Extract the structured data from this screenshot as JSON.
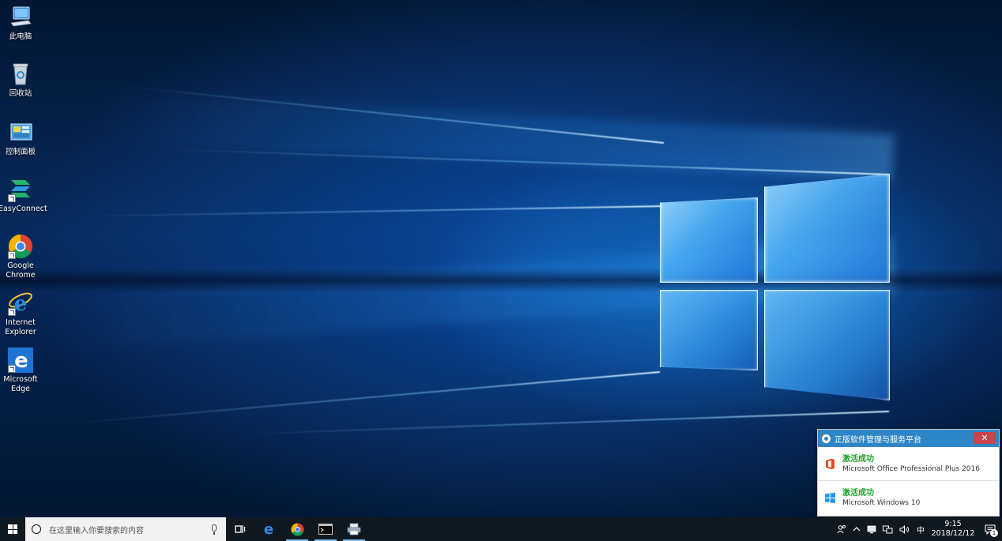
{
  "desktop": {
    "icons": [
      {
        "label": "此电脑",
        "icon": "computer-icon"
      },
      {
        "label": "回收站",
        "icon": "recycle-bin-icon"
      },
      {
        "label": "控制面板",
        "icon": "control-panel-icon"
      },
      {
        "label": "EasyConnect",
        "icon": "easyconnect-icon"
      },
      {
        "label": "Google\nChrome",
        "icon": "chrome-icon"
      },
      {
        "label": "Internet\nExplorer",
        "icon": "internet-explorer-icon"
      },
      {
        "label": "Microsoft\nEdge",
        "icon": "edge-icon"
      }
    ]
  },
  "popup": {
    "title": "正版软件管理与服务平台",
    "close_label": "✕",
    "items": [
      {
        "status": "激活成功",
        "product": "Microsoft Office Professional Plus 2016",
        "icon": "office-icon"
      },
      {
        "status": "激活成功",
        "product": "Microsoft Windows 10",
        "icon": "windows-icon"
      }
    ]
  },
  "taskbar": {
    "search_placeholder": "在这里输入你要搜索的内容",
    "pinned": [
      "task-view-icon",
      "edge-icon",
      "chrome-icon",
      "command-prompt-icon",
      "printer-icon"
    ],
    "tray": {
      "ime_label": "中",
      "time": "9:15",
      "date": "2018/12/12",
      "notification_count": "1"
    }
  },
  "colors": {
    "accent": "#2f86c6",
    "success": "#1aa329",
    "close": "#c9434a",
    "taskbar": "#101820"
  }
}
